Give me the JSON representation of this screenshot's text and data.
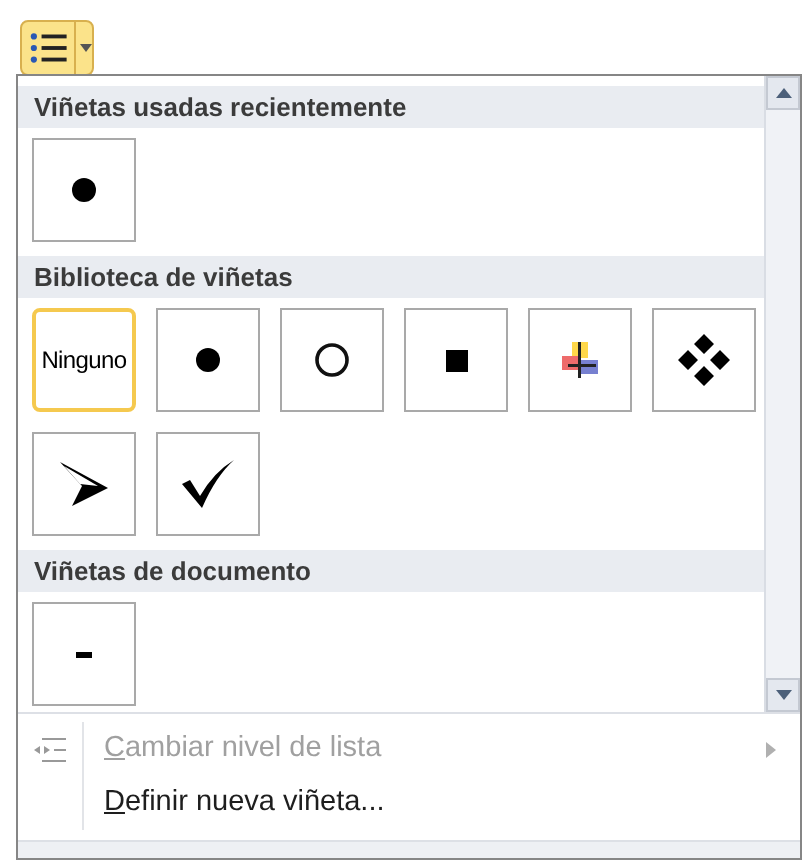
{
  "toolbar_button": {
    "selected": true
  },
  "sections": [
    {
      "title": "Viñetas usadas recientemente",
      "items": [
        {
          "kind": "dot",
          "selected": false
        }
      ]
    },
    {
      "title": "Biblioteca de viñetas",
      "items": [
        {
          "kind": "none",
          "label": "Ninguno",
          "selected": true
        },
        {
          "kind": "dot",
          "selected": false
        },
        {
          "kind": "circle",
          "selected": false
        },
        {
          "kind": "square",
          "selected": false
        },
        {
          "kind": "cross",
          "selected": false
        },
        {
          "kind": "diamonds",
          "selected": false
        },
        {
          "kind": "arrow",
          "selected": false
        },
        {
          "kind": "check",
          "selected": false
        }
      ]
    },
    {
      "title": "Viñetas de documento",
      "items": [
        {
          "kind": "dash",
          "selected": false
        }
      ]
    }
  ],
  "menu_items": [
    {
      "label": "Cambiar nivel de lista",
      "disabled": true,
      "submenu": true,
      "icon": true
    },
    {
      "label": "Definir nueva viñeta...",
      "disabled": false,
      "submenu": false,
      "icon": false
    }
  ]
}
